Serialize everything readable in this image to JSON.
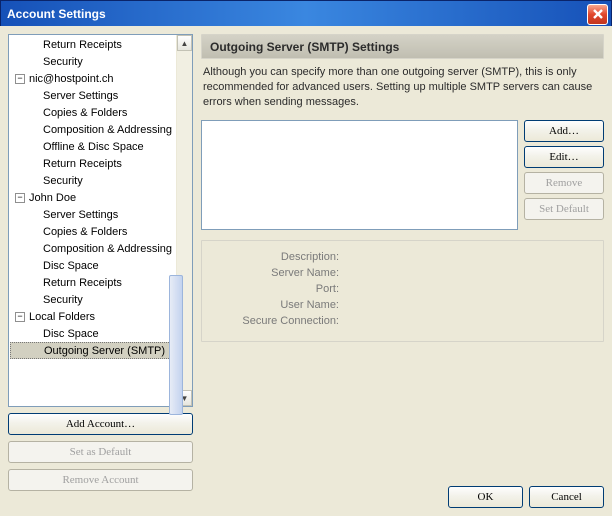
{
  "window": {
    "title": "Account Settings"
  },
  "tree": {
    "rows": [
      {
        "label": "Return Receipts",
        "cls": "child"
      },
      {
        "label": "Security",
        "cls": "child"
      },
      {
        "label": "nic@hostpoint.ch",
        "cls": "parent",
        "exp": "−"
      },
      {
        "label": "Server Settings",
        "cls": "child"
      },
      {
        "label": "Copies & Folders",
        "cls": "child"
      },
      {
        "label": "Composition & Addressing",
        "cls": "child"
      },
      {
        "label": "Offline & Disc Space",
        "cls": "child"
      },
      {
        "label": "Return Receipts",
        "cls": "child"
      },
      {
        "label": "Security",
        "cls": "child"
      },
      {
        "label": "John Doe",
        "cls": "parent",
        "exp": "−"
      },
      {
        "label": "Server Settings",
        "cls": "child"
      },
      {
        "label": "Copies & Folders",
        "cls": "child"
      },
      {
        "label": "Composition & Addressing",
        "cls": "child"
      },
      {
        "label": "Disc Space",
        "cls": "child"
      },
      {
        "label": "Return Receipts",
        "cls": "child"
      },
      {
        "label": "Security",
        "cls": "child"
      },
      {
        "label": "Local Folders",
        "cls": "parent",
        "exp": "−"
      },
      {
        "label": "Disc Space",
        "cls": "child"
      },
      {
        "label": "Outgoing Server (SMTP)",
        "cls": "child selected"
      }
    ]
  },
  "left_buttons": {
    "add": "Add Account…",
    "set_default": "Set as Default",
    "remove": "Remove Account"
  },
  "panel": {
    "heading": "Outgoing Server (SMTP) Settings",
    "description": "Although you can specify more than one outgoing server (SMTP), this is only recommended for advanced users. Setting up multiple SMTP servers can cause errors when sending messages."
  },
  "right_buttons": {
    "add": "Add…",
    "edit": "Edit…",
    "remove": "Remove",
    "set_default": "Set Default"
  },
  "details": {
    "description_label": "Description:",
    "server_name_label": "Server Name:",
    "port_label": "Port:",
    "user_name_label": "User Name:",
    "secure_label": "Secure Connection:"
  },
  "footer": {
    "ok": "OK",
    "cancel": "Cancel"
  }
}
